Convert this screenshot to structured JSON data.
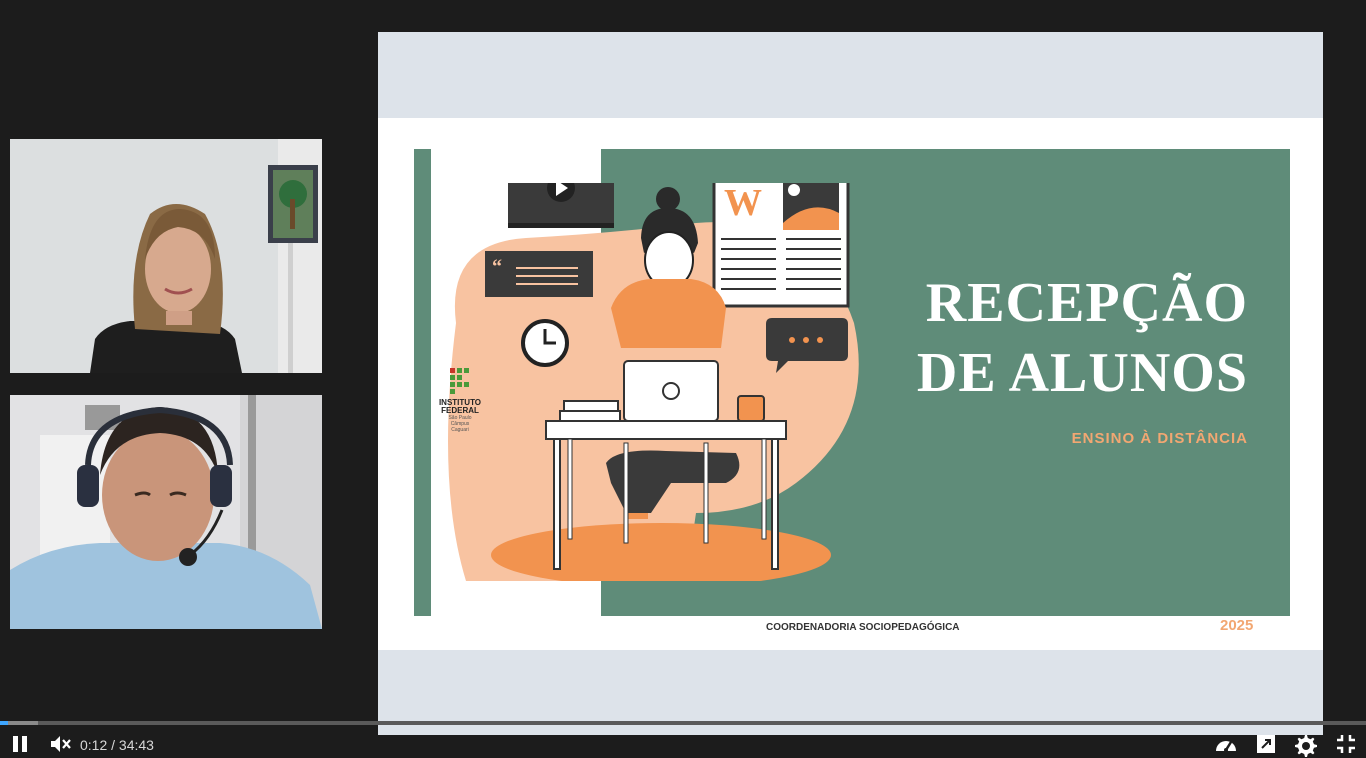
{
  "webcams": [
    {
      "label": "participant-woman"
    },
    {
      "label": "participant-man-headset"
    }
  ],
  "slide": {
    "title_line1": "RECEPÇÃO",
    "title_line2": "DE ALUNOS",
    "subtitle": "ENSINO À DISTÂNCIA",
    "footer": "COORDENADORIA SOCIOPEDAGÓGICA",
    "year": "2025",
    "logo": {
      "line1": "INSTITUTO",
      "line2": "FEDERAL",
      "line3": "São Paulo",
      "line4": "Câmpus",
      "line5": "Caguari"
    },
    "newspaper_letter": "W",
    "colors": {
      "green": "#5f8c79",
      "peach": "#f8c3a1",
      "orange": "#f2934f",
      "dark": "#3a3a3a"
    }
  },
  "player": {
    "current_time": "0:12",
    "duration": "34:43",
    "time_display": "0:12 / 34:43",
    "progress_fraction": 0.006,
    "buffer_fraction": 0.028,
    "icons": [
      "pause-icon",
      "mute-icon",
      "speed-icon",
      "open-external-icon",
      "settings-icon",
      "exit-fullscreen-icon"
    ]
  }
}
